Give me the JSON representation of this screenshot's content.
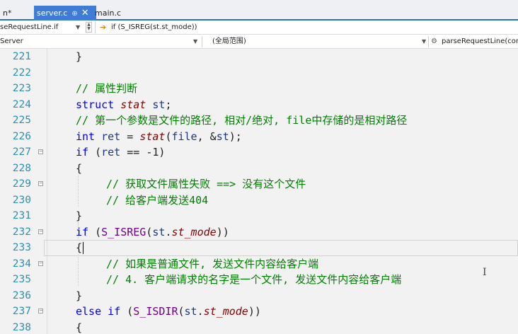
{
  "tabs": [
    {
      "label": "n*",
      "active": false
    },
    {
      "label": "server.c",
      "active": true,
      "pin": "⊕",
      "close": "✕"
    },
    {
      "label": "main.c",
      "active": false
    }
  ],
  "navbar": {
    "function_combo": "seRequestLine.if",
    "breadcrumb": "if (S_ISREG(st.st_mode))"
  },
  "scopebar": {
    "project": "Server",
    "scope": "(全局范围)",
    "member": "parseRequestLine(cor"
  },
  "editor": {
    "lines": [
      {
        "n": "221",
        "fold": false,
        "indent": 1,
        "tokens": [
          {
            "t": "}",
            "c": ""
          }
        ]
      },
      {
        "n": "222",
        "fold": false,
        "indent": 1,
        "tokens": []
      },
      {
        "n": "223",
        "fold": false,
        "indent": 1,
        "tokens": [
          {
            "t": "// 属性判断",
            "c": "cm"
          }
        ]
      },
      {
        "n": "224",
        "fold": false,
        "indent": 1,
        "tokens": [
          {
            "t": "struct ",
            "c": "kw"
          },
          {
            "t": "stat",
            "c": "fn"
          },
          {
            "t": " ",
            "c": ""
          },
          {
            "t": "st",
            "c": "var"
          },
          {
            "t": ";",
            "c": ""
          }
        ]
      },
      {
        "n": "225",
        "fold": false,
        "indent": 1,
        "tokens": [
          {
            "t": "// 第一个参数是文件的路径, 相对/绝对, file中存储的是相对路径",
            "c": "cm"
          }
        ]
      },
      {
        "n": "226",
        "fold": false,
        "indent": 1,
        "tokens": [
          {
            "t": "int ",
            "c": "kw"
          },
          {
            "t": "ret",
            "c": "var"
          },
          {
            "t": " = ",
            "c": ""
          },
          {
            "t": "stat",
            "c": "fn"
          },
          {
            "t": "(",
            "c": ""
          },
          {
            "t": "file",
            "c": "var"
          },
          {
            "t": ", &",
            "c": ""
          },
          {
            "t": "st",
            "c": "var"
          },
          {
            "t": ");",
            "c": ""
          }
        ]
      },
      {
        "n": "227",
        "fold": true,
        "indent": 1,
        "tokens": [
          {
            "t": "if ",
            "c": "kw"
          },
          {
            "t": "(",
            "c": ""
          },
          {
            "t": "ret",
            "c": "var"
          },
          {
            "t": " == -1)",
            "c": ""
          }
        ]
      },
      {
        "n": "228",
        "fold": false,
        "indent": 1,
        "tokens": [
          {
            "t": "{",
            "c": ""
          }
        ]
      },
      {
        "n": "229",
        "fold": true,
        "indent": 2,
        "tokens": [
          {
            "t": "// 获取文件属性失败 ==> 没有这个文件",
            "c": "cm"
          }
        ]
      },
      {
        "n": "230",
        "fold": false,
        "indent": 2,
        "tokens": [
          {
            "t": "// 给客户端发送404",
            "c": "cm"
          }
        ]
      },
      {
        "n": "231",
        "fold": false,
        "indent": 1,
        "tokens": [
          {
            "t": "}",
            "c": ""
          }
        ]
      },
      {
        "n": "232",
        "fold": true,
        "indent": 1,
        "tokens": [
          {
            "t": "if ",
            "c": "kw"
          },
          {
            "t": "(",
            "c": ""
          },
          {
            "t": "S_ISREG",
            "c": "mac"
          },
          {
            "t": "(",
            "c": ""
          },
          {
            "t": "st",
            "c": "var"
          },
          {
            "t": ".",
            "c": ""
          },
          {
            "t": "st_mode",
            "c": "fn"
          },
          {
            "t": "))",
            "c": ""
          }
        ]
      },
      {
        "n": "233",
        "fold": false,
        "indent": 1,
        "current": true,
        "tokens": [
          {
            "t": "{",
            "c": ""
          }
        ]
      },
      {
        "n": "234",
        "fold": true,
        "indent": 2,
        "tokens": [
          {
            "t": "// 如果是普通文件, 发送文件内容给客户端",
            "c": "cm"
          }
        ]
      },
      {
        "n": "235",
        "fold": false,
        "indent": 2,
        "tokens": [
          {
            "t": "// 4. 客户端请求的名字是一个文件, 发送文件内容给客户端",
            "c": "cm"
          }
        ]
      },
      {
        "n": "236",
        "fold": false,
        "indent": 1,
        "tokens": [
          {
            "t": "}",
            "c": ""
          }
        ]
      },
      {
        "n": "237",
        "fold": true,
        "indent": 1,
        "tokens": [
          {
            "t": "else if ",
            "c": "kw"
          },
          {
            "t": "(",
            "c": ""
          },
          {
            "t": "S_ISDIR",
            "c": "mac"
          },
          {
            "t": "(",
            "c": ""
          },
          {
            "t": "st",
            "c": "var"
          },
          {
            "t": ".",
            "c": ""
          },
          {
            "t": "st_mode",
            "c": "fn"
          },
          {
            "t": "))",
            "c": ""
          }
        ]
      },
      {
        "n": "238",
        "fold": false,
        "indent": 1,
        "tokens": [
          {
            "t": "{",
            "c": ""
          }
        ]
      }
    ]
  },
  "colors": {
    "active_tab": "#3e7cd6",
    "keyword": "#0000ff",
    "comment": "#008000",
    "line_number": "#2b91af"
  }
}
